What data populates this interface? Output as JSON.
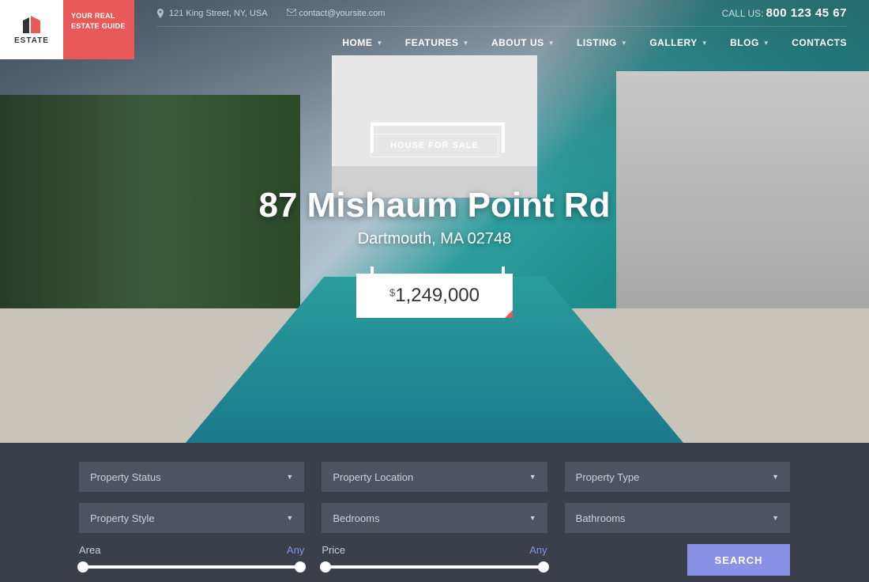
{
  "logo": {
    "text": "ESTATE"
  },
  "tagline": "YOUR REAL ESTATE GUIDE",
  "topbar": {
    "address": "121 King Street, NY, USA",
    "email": "contact@yoursite.com",
    "callus_label": "CALL US:",
    "phone": "800 123 45 67"
  },
  "nav": [
    {
      "label": "HOME",
      "dropdown": true
    },
    {
      "label": "FEATURES",
      "dropdown": true
    },
    {
      "label": "ABOUT US",
      "dropdown": true
    },
    {
      "label": "LISTING",
      "dropdown": true
    },
    {
      "label": "GALLERY",
      "dropdown": true
    },
    {
      "label": "BLOG",
      "dropdown": true
    },
    {
      "label": "CONTACTS",
      "dropdown": false
    }
  ],
  "hero": {
    "badge": "HOUSE FOR SALE",
    "title": "87 Mishaum Point Rd",
    "subtitle": "Dartmouth, MA 02748",
    "price_currency": "$",
    "price": "1,249,000"
  },
  "search": {
    "dropdowns": [
      "Property Status",
      "Property Location",
      "Property Type",
      "Property Style",
      "Bedrooms",
      "Bathrooms"
    ],
    "sliders": [
      {
        "label": "Area",
        "value": "Any"
      },
      {
        "label": "Price",
        "value": "Any"
      }
    ],
    "button": "SEARCH"
  }
}
